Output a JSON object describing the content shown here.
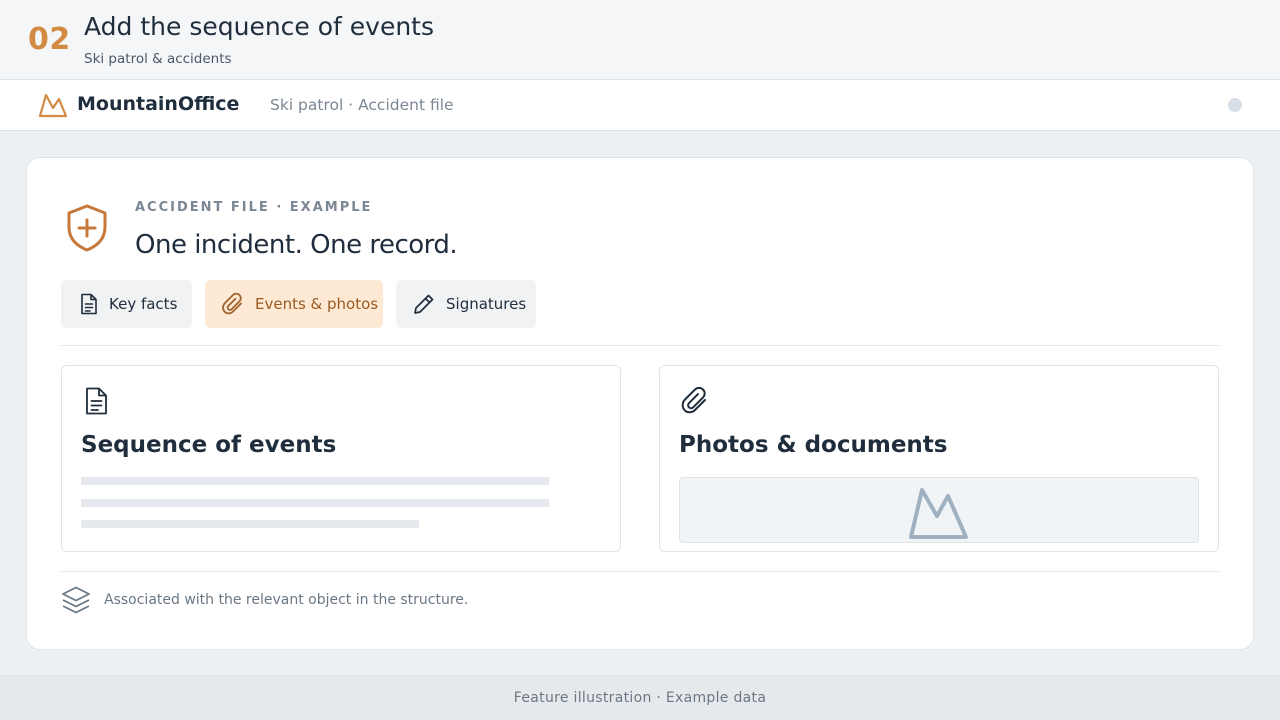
{
  "step": {
    "number": "02",
    "title": "Add the sequence of events",
    "subtitle": "Ski patrol & accidents"
  },
  "nav": {
    "brand": "MountainOffice",
    "breadcrumb": "Ski patrol · Accident file",
    "logo_icon": "mountain-icon"
  },
  "card": {
    "eyebrow": "ACCIDENT FILE · EXAMPLE",
    "headline": "One incident. One record.",
    "tabs": [
      {
        "label": "Key facts",
        "icon": "document-icon",
        "active": false
      },
      {
        "label": "Events & photos",
        "icon": "paperclip-icon",
        "active": true
      },
      {
        "label": "Signatures",
        "icon": "pen-icon",
        "active": false
      }
    ],
    "panels": {
      "events": {
        "title": "Sequence of events",
        "icon": "document-icon"
      },
      "photos": {
        "title": "Photos & documents",
        "icon": "paperclip-icon"
      }
    },
    "footnote": "Associated with the relevant object in the structure."
  },
  "footer": {
    "text": "Feature illustration · Example data"
  },
  "colors": {
    "accent": "#d38a43",
    "active_tab_bg": "#fde9d4",
    "text": "#1f2d3d",
    "muted": "#7b8794"
  }
}
